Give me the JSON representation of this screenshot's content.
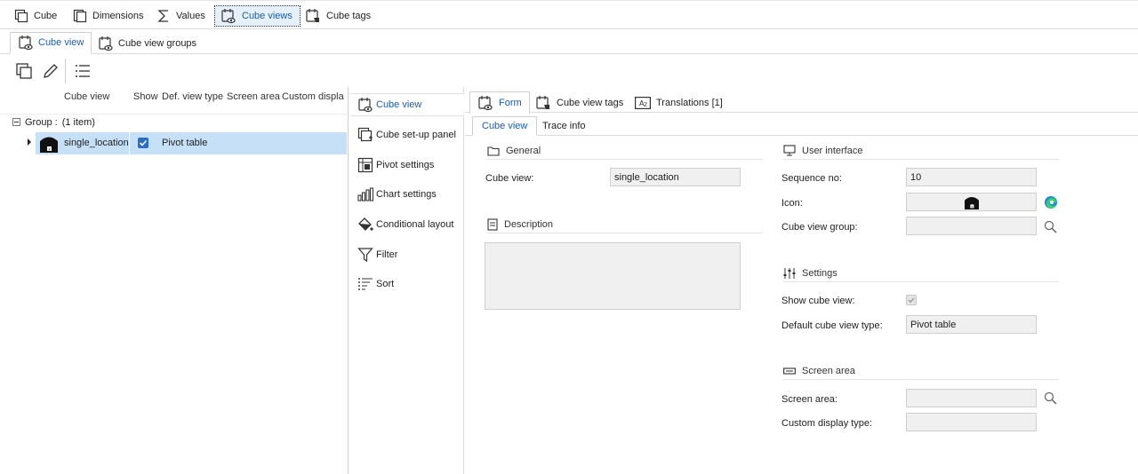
{
  "top_menu": {
    "items": [
      {
        "label": "Cube",
        "icon": "cube-icon"
      },
      {
        "label": "Dimensions",
        "icon": "dimensions-icon"
      },
      {
        "label": "Values",
        "icon": "sigma-icon"
      },
      {
        "label": "Cube views",
        "icon": "cube-view-icon",
        "active": true
      },
      {
        "label": "Cube tags",
        "icon": "cube-tag-icon"
      }
    ]
  },
  "sub_tabs": {
    "items": [
      {
        "label": "Cube view",
        "icon": "cube-view-icon",
        "active": true
      },
      {
        "label": "Cube view groups",
        "icon": "cube-view-groups-icon"
      }
    ]
  },
  "toolbar": {
    "buttons": [
      "copy-icon",
      "edit-icon",
      "list-icon"
    ]
  },
  "grid": {
    "columns": [
      "Cube view",
      "Show",
      "Def. view type",
      "Screen area",
      "Custom display"
    ],
    "group_label": "Group :",
    "group_count": "(1 item)",
    "rows": [
      {
        "name": "single_location",
        "show": true,
        "view_type": "Pivot table"
      }
    ]
  },
  "side_nav": {
    "items": [
      {
        "label": "Cube view",
        "icon": "cube-view-icon",
        "active": true
      },
      {
        "label": "Cube set-up panel",
        "icon": "setup-panel-icon"
      },
      {
        "label": "Pivot settings",
        "icon": "pivot-icon"
      },
      {
        "label": "Chart settings",
        "icon": "chart-icon"
      },
      {
        "label": "Conditional layout",
        "icon": "paint-bucket-icon"
      },
      {
        "label": "Filter",
        "icon": "filter-icon"
      },
      {
        "label": "Sort",
        "icon": "sort-icon"
      }
    ]
  },
  "form_tabs": {
    "items": [
      {
        "label": "Form",
        "icon": "form-icon",
        "active": true
      },
      {
        "label": "Cube view tags",
        "icon": "cube-tag-icon"
      },
      {
        "label": "Translations [1]",
        "icon": "translate-icon"
      }
    ]
  },
  "inner_tabs": {
    "items": [
      {
        "label": "Cube view",
        "active": true
      },
      {
        "label": "Trace info"
      }
    ]
  },
  "general": {
    "title": "General",
    "cube_view_label": "Cube view:",
    "cube_view_value": "single_location",
    "description_title": "Description",
    "description_value": ""
  },
  "user_interface": {
    "title": "User interface",
    "sequence_label": "Sequence no:",
    "sequence_value": "10",
    "icon_label": "Icon:",
    "group_label": "Cube view group:",
    "group_value": ""
  },
  "settings": {
    "title": "Settings",
    "show_label": "Show cube view:",
    "show_value": true,
    "default_type_label": "Default cube view type:",
    "default_type_value": "Pivot table"
  },
  "screen_area": {
    "title": "Screen area",
    "screen_area_label": "Screen area:",
    "screen_area_value": "",
    "custom_display_label": "Custom display type:",
    "custom_display_value": ""
  },
  "colors": {
    "accent": "#1a5fa8",
    "selection": "#c6e0f7",
    "checkbox": "#2b6cc4",
    "field_bg": "#f0f0f0"
  }
}
